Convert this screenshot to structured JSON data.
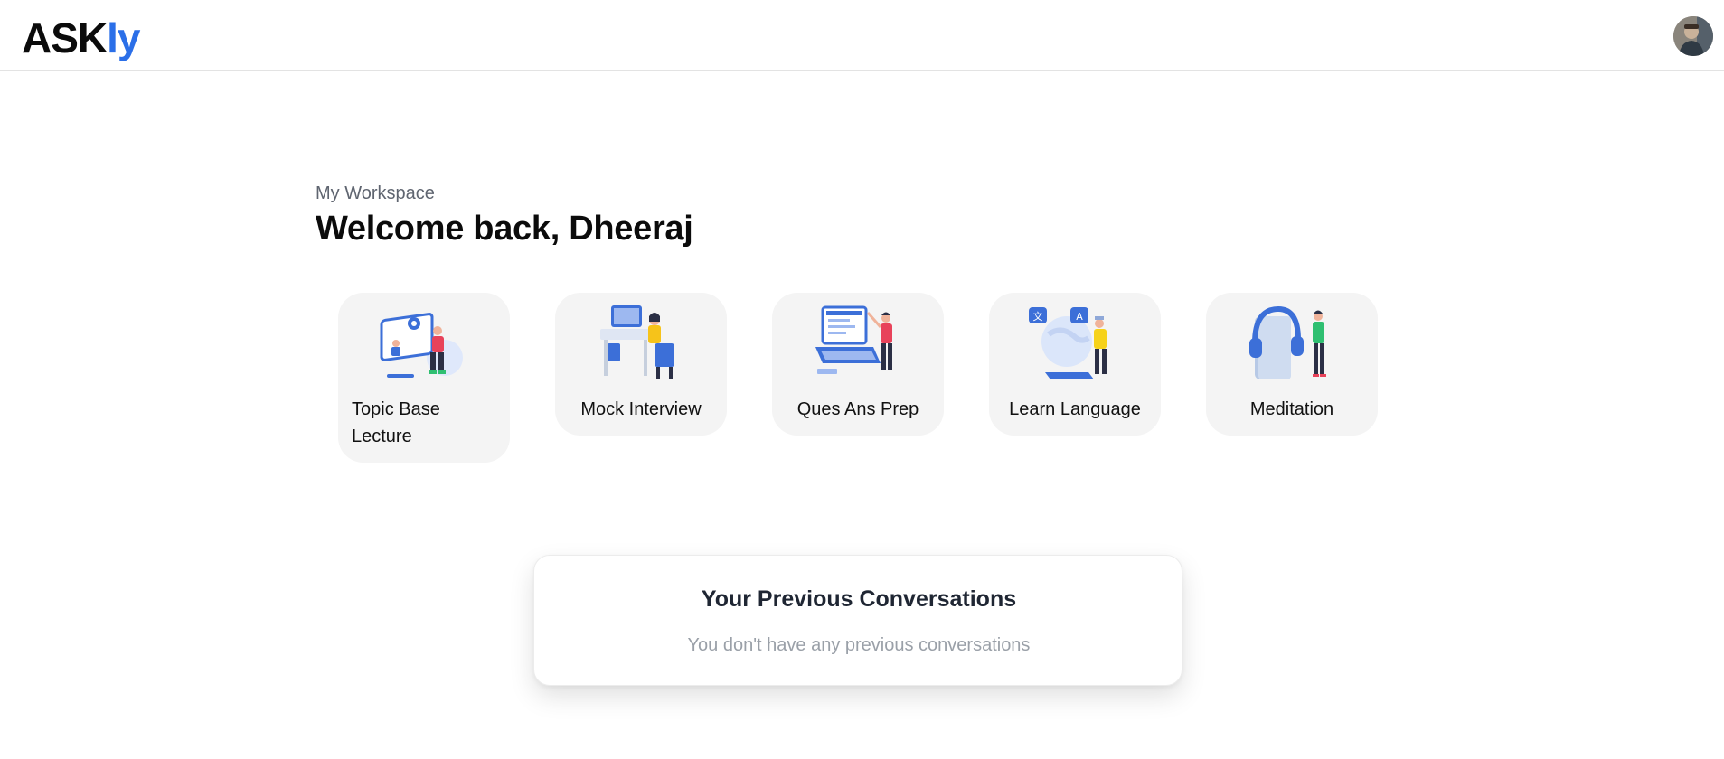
{
  "header": {
    "logo_part1": "ASK",
    "logo_part2": "ly",
    "logo_colors": {
      "primary": "#0b0b0b",
      "accent": "#2b6fe8"
    },
    "avatar_icon": "user-avatar"
  },
  "workspace": {
    "label": "My Workspace",
    "welcome": "Welcome back, Dheeraj"
  },
  "cards": [
    {
      "label": "Topic Base Lecture",
      "icon": "lecture-illustration"
    },
    {
      "label": "Mock Interview",
      "icon": "interview-illustration"
    },
    {
      "label": "Ques Ans Prep",
      "icon": "laptop-illustration"
    },
    {
      "label": "Learn Language",
      "icon": "language-illustration"
    },
    {
      "label": "Meditation",
      "icon": "headphones-illustration"
    }
  ],
  "previous": {
    "title": "Your Previous Conversations",
    "empty_text": "You don't have any previous conversations"
  }
}
